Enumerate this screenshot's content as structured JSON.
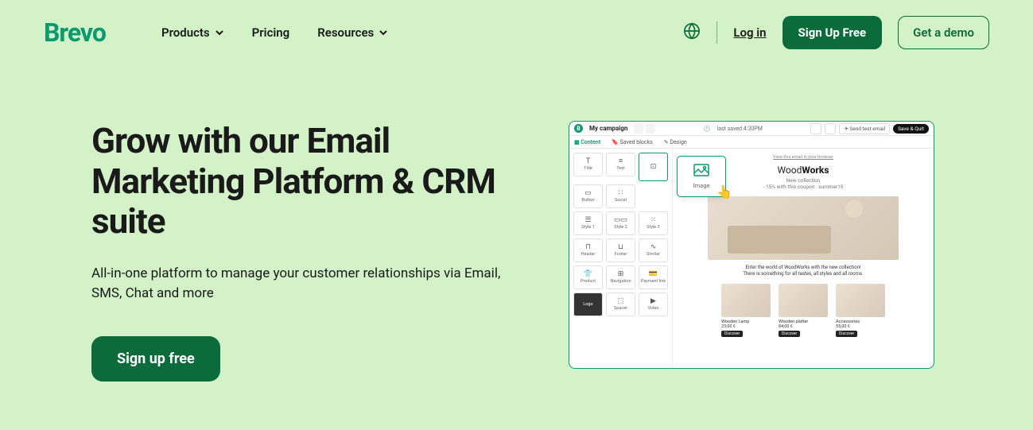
{
  "header": {
    "logo": "Brevo",
    "nav": {
      "products": "Products",
      "pricing": "Pricing",
      "resources": "Resources"
    },
    "login": "Log in",
    "signup": "Sign Up Free",
    "demo": "Get a demo"
  },
  "hero": {
    "title": "Grow with our Email Marketing Platform & CRM suite",
    "subtitle": "All-in-one platform to manage your customer relationships via Email, SMS, Chat and more",
    "cta": "Sign up free"
  },
  "app": {
    "brand_letter": "B",
    "title": "My campaign",
    "last_saved": "last saved 4:30PM",
    "send_test": "Send test email",
    "save_quit": "Save & Quit",
    "tabs": {
      "content": "Content",
      "saved": "Saved blocks",
      "design": "Design"
    },
    "blocks": {
      "title": "Title",
      "text": "Text",
      "button": "Button",
      "social": "Social",
      "style1": "Style 1",
      "style2": "Style 2",
      "style3": "Style 3",
      "header": "Header",
      "footer": "Footer",
      "similar": "Similar",
      "product": "Product",
      "navigation": "Navigation",
      "payment": "Payment link",
      "logo": "Logo",
      "spacer": "Spacer",
      "video": "Video"
    },
    "floating": "Image",
    "canvas": {
      "view": "View this email in your browser",
      "brand_light": "Wood",
      "brand_bold": "Works",
      "new_collection": "New collection",
      "coupon": "- 15% with this coupon : summer15",
      "desc1": "Enter the world of WoodWorks with the new collection!",
      "desc2": "There is something for all tastes, all styles and all rooms.",
      "products": [
        {
          "name": "Wooden Lamp",
          "price": "23,00 €",
          "btn": "Discover"
        },
        {
          "name": "Wooden platter",
          "price": "84,00 €",
          "btn": "Discover"
        },
        {
          "name": "Accessories",
          "price": "55,00 €",
          "btn": "Discover"
        }
      ]
    }
  }
}
